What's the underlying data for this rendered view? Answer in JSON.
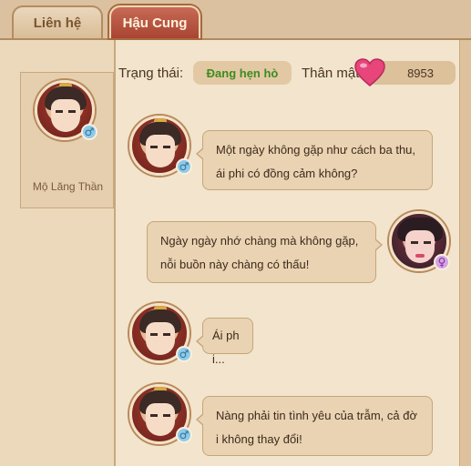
{
  "tabs": [
    {
      "label": "Liên hệ",
      "active": false
    },
    {
      "label": "Hậu Cung",
      "active": true
    }
  ],
  "contact": {
    "name": "Mộ Lăng Thần",
    "gender_icon": "male-icon"
  },
  "status": {
    "label": "Trạng thái:",
    "value": "Đang hẹn hò",
    "value_color": "#3f8a1f"
  },
  "intimacy": {
    "label": "Thân mật:",
    "value": "8953",
    "icon": "heart-icon"
  },
  "messages": [
    {
      "sender": "npc",
      "text": "Một ngày không gặp như cách ba thu, ái phi có đồng cảm không?"
    },
    {
      "sender": "player",
      "text": "Ngày ngày nhớ chàng mà không gặp, nỗi buồn này chàng có thấu!"
    },
    {
      "sender": "npc",
      "text": "Ái phi..."
    },
    {
      "sender": "npc",
      "text": "Nàng phải tin tình yêu của trẫm, cả đời không thay đổi!"
    }
  ],
  "colors": {
    "active_tab": "#b04a38",
    "bubble": "#e9d3b2",
    "heart": "#e8457a"
  }
}
